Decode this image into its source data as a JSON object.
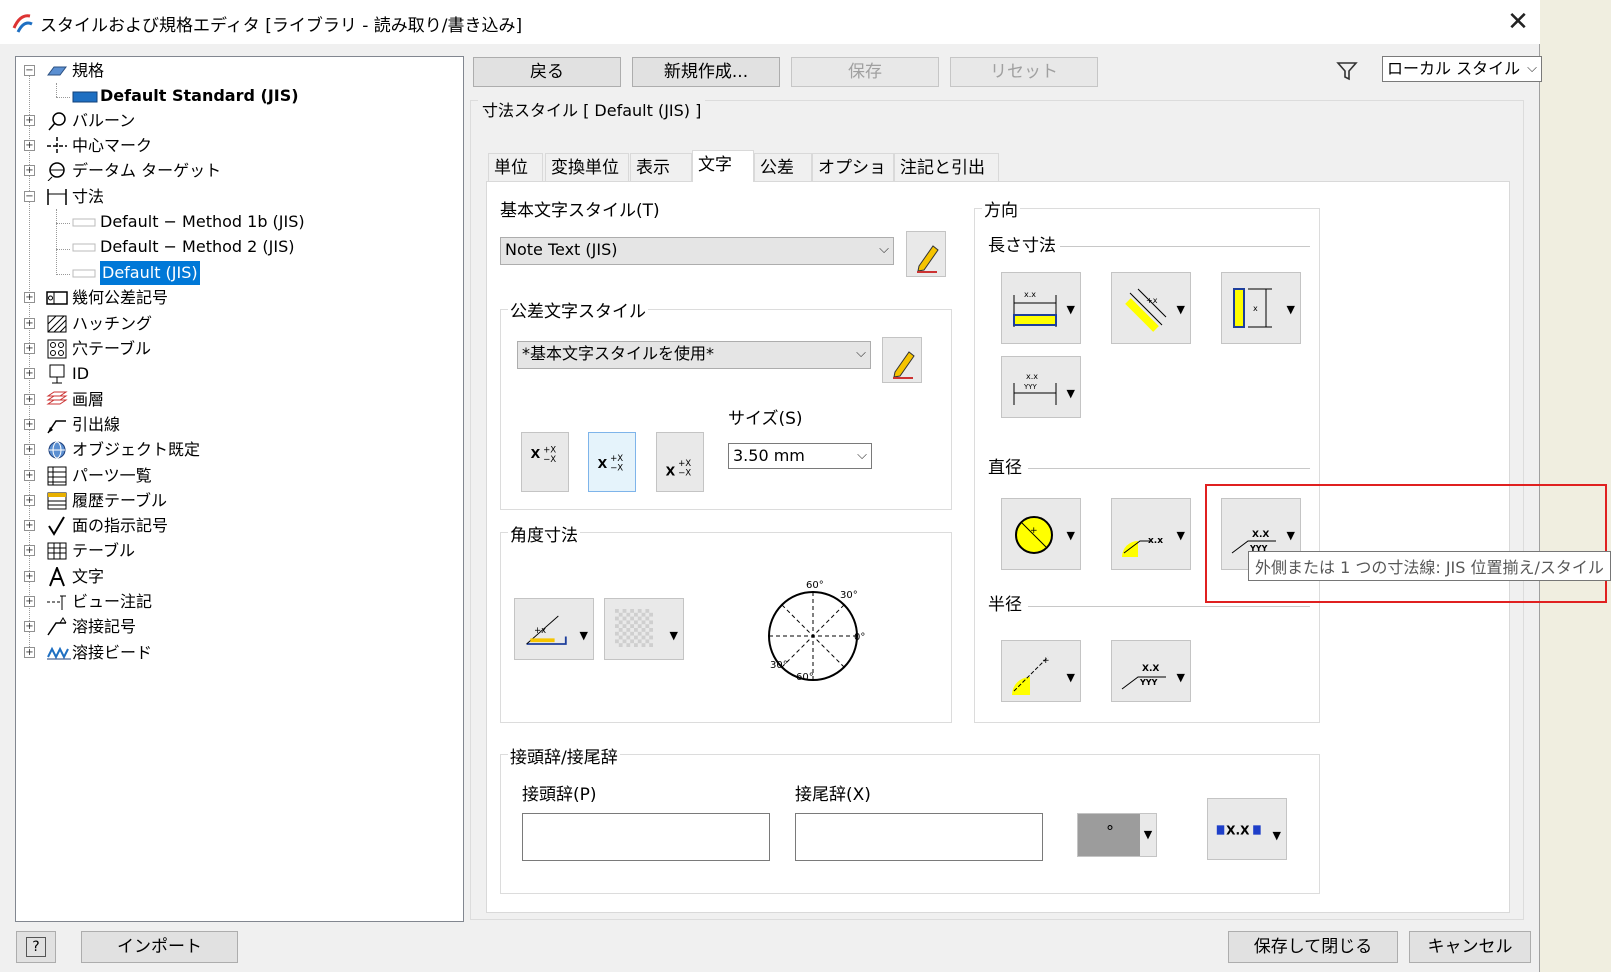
{
  "window": {
    "title": "スタイルおよび規格エディタ [ライブラリ - 読み取り/書き込み]",
    "close_glyph": "✕"
  },
  "tree": {
    "items": [
      {
        "label": "規格",
        "exp": "−"
      },
      {
        "label": "Default Standard (JIS)"
      },
      {
        "label": "バルーン",
        "exp": "+"
      },
      {
        "label": "中心マーク",
        "exp": "+"
      },
      {
        "label": "データム ターゲット",
        "exp": "+"
      },
      {
        "label": "寸法",
        "exp": "−"
      },
      {
        "label": "Default − Method 1b (JIS)"
      },
      {
        "label": "Default − Method 2 (JIS)"
      },
      {
        "label": "Default (JIS)"
      },
      {
        "label": "幾何公差記号",
        "exp": "+"
      },
      {
        "label": "ハッチング",
        "exp": "+"
      },
      {
        "label": "穴テーブル",
        "exp": "+"
      },
      {
        "label": "ID",
        "exp": "+"
      },
      {
        "label": "画層",
        "exp": "+"
      },
      {
        "label": "引出線",
        "exp": "+"
      },
      {
        "label": "オブジェクト既定",
        "exp": "+"
      },
      {
        "label": "パーツ一覧",
        "exp": "+"
      },
      {
        "label": "履歴テーブル",
        "exp": "+"
      },
      {
        "label": "面の指示記号",
        "exp": "+"
      },
      {
        "label": "テーブル",
        "exp": "+"
      },
      {
        "label": "文字",
        "exp": "+"
      },
      {
        "label": "ビュー注記",
        "exp": "+"
      },
      {
        "label": "溶接記号",
        "exp": "+"
      },
      {
        "label": "溶接ビード",
        "exp": "+"
      }
    ]
  },
  "toolbar": {
    "back": "戻る",
    "new": "新規作成...",
    "save": "保存",
    "reset": "リセット",
    "filter_value": "ローカル スタイル"
  },
  "style_header": "寸法スタイル [ Default (JIS) ]",
  "tabs": [
    "単位",
    "変換単位",
    "表示",
    "文字",
    "公差",
    "オプション",
    "注記と引出線"
  ],
  "text_tab": {
    "base_text_style_label": "基本文字スタイル(T)",
    "base_text_style_value": "Note Text (JIS)",
    "tolerance_text_group": "公差文字スタイル",
    "tolerance_text_value": "*基本文字スタイルを使用*",
    "size_label": "サイズ(S)",
    "size_value": "3.50 mm",
    "angle_group": "角度寸法",
    "prefix_group": "接頭辞/接尾辞",
    "prefix_label": "接頭辞(P)",
    "suffix_label": "接尾辞(X)",
    "symbol_glyph": "°",
    "orientation_group": "方向",
    "linear_label": "長さ寸法",
    "diameter_label": "直径",
    "radius_label": "半径"
  },
  "tooltip": "外側または 1 つの寸法線: JIS 位置揃え/スタイル",
  "bottom": {
    "import": "インポート",
    "save_close": "保存して閉じる",
    "cancel": "キャンセル",
    "help_glyph": "?"
  },
  "colors": {
    "selection": "#0078d7",
    "highlight": "#e02020",
    "yellow": "#ffff00"
  },
  "glyphs": {
    "dropdown": "▼",
    "combo_arrow": "⌵"
  },
  "icon_text": {
    "xx": "X.X",
    "yyy": "YYY",
    "xxx_small": "x.x",
    "prefix_suffix_sample": "X.X"
  },
  "dial": [
    "60°",
    "30°",
    "0°",
    "30°",
    "60°"
  ]
}
